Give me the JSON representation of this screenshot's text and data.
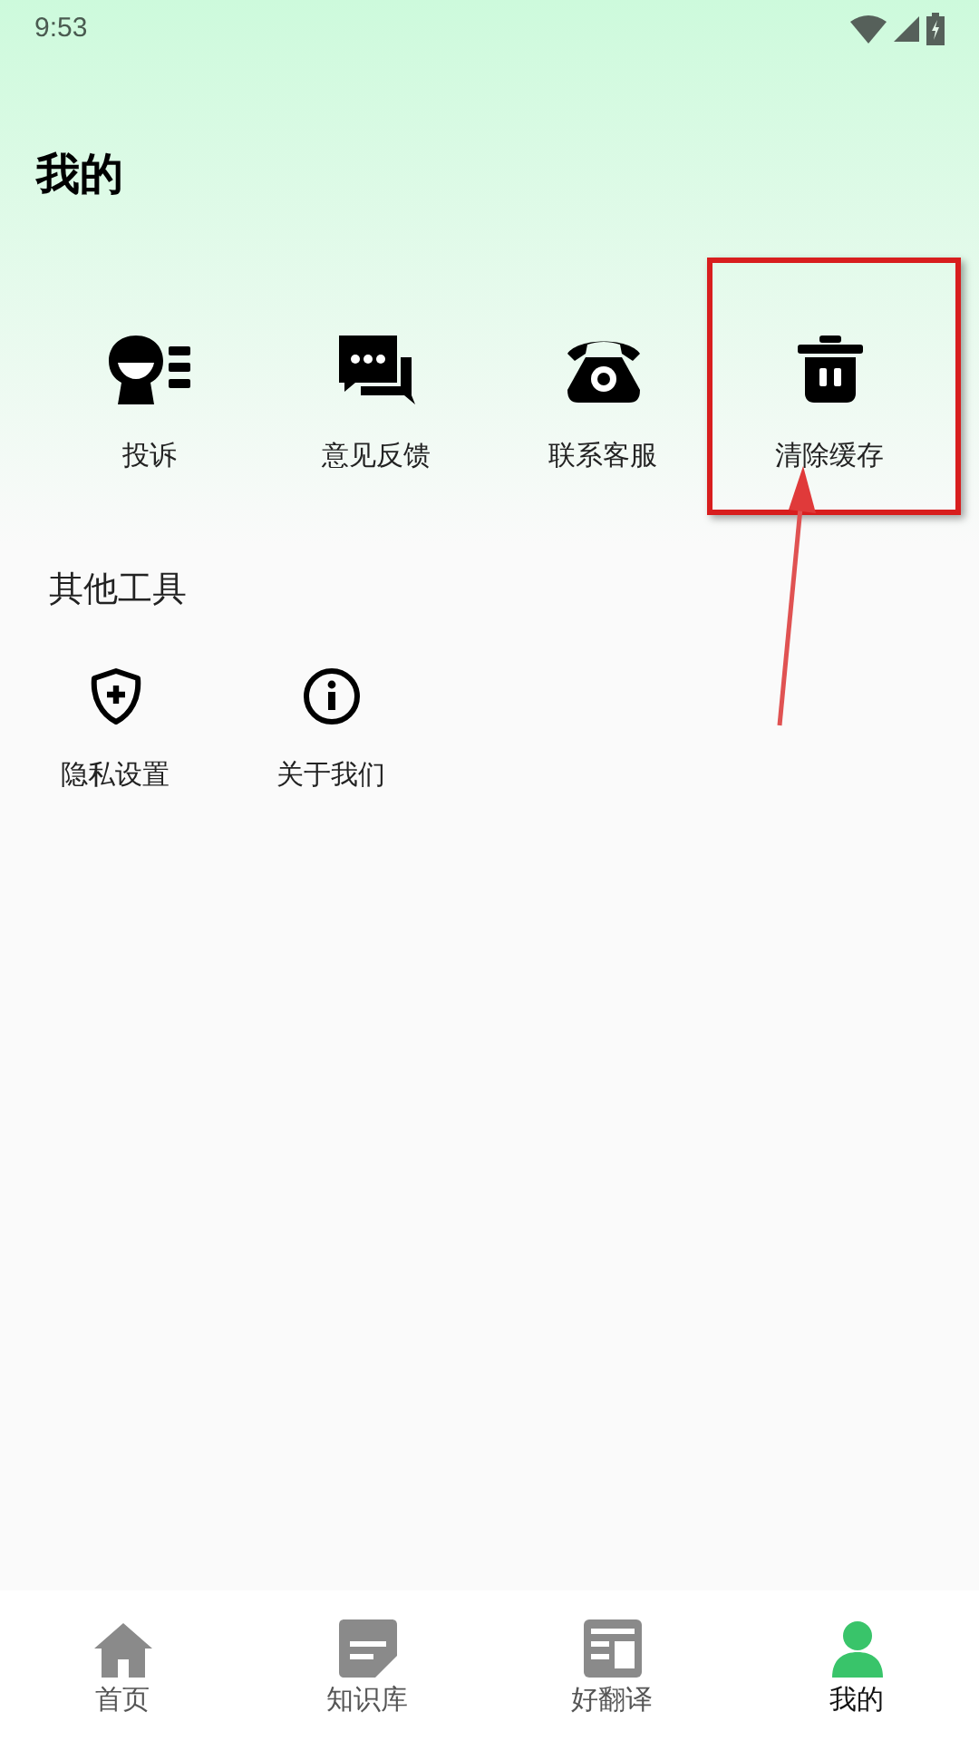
{
  "status_bar": {
    "time": "9:53"
  },
  "title": "我的",
  "actions": [
    {
      "kind": "complain",
      "label": "投诉"
    },
    {
      "kind": "feedback",
      "label": "意见反馈"
    },
    {
      "kind": "phone",
      "label": "联系客服"
    },
    {
      "kind": "trash",
      "label": "清除缓存",
      "highlighted": true
    }
  ],
  "other_tools": {
    "heading": "其他工具",
    "items": [
      {
        "kind": "shield",
        "label": "隐私设置"
      },
      {
        "kind": "info",
        "label": "关于我们"
      }
    ]
  },
  "bottom_nav": [
    {
      "kind": "home",
      "label": "首页",
      "selected": false
    },
    {
      "kind": "doc",
      "label": "知识库",
      "selected": false
    },
    {
      "kind": "translate",
      "label": "好翻译",
      "selected": false
    },
    {
      "kind": "person",
      "label": "我的",
      "selected": true
    }
  ]
}
